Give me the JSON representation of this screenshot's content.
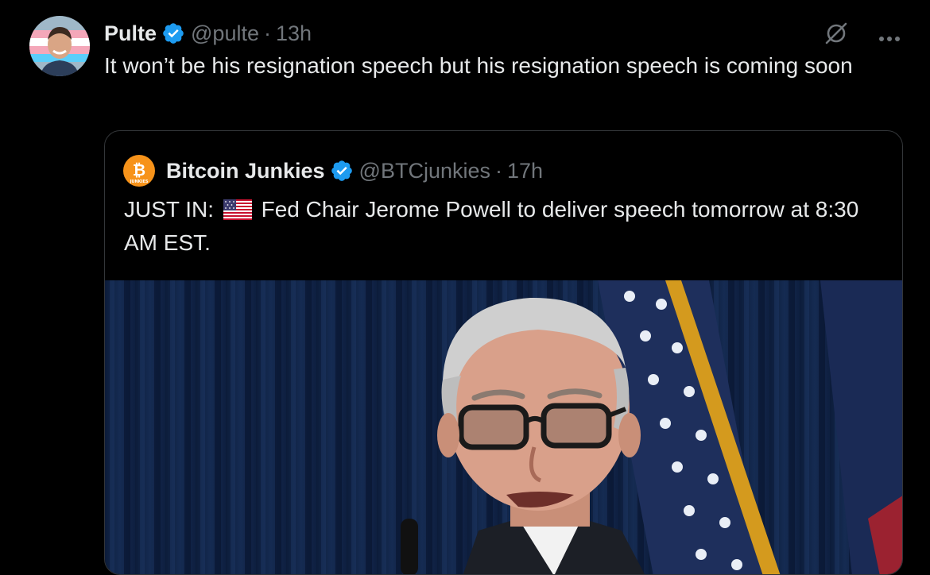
{
  "tweet": {
    "name": "Pulte",
    "handle": "@pulte",
    "separator": "·",
    "time": "13h",
    "text": "It won’t be his resignation speech but his resignation speech is coming soon",
    "more_label": "···"
  },
  "quote": {
    "name": "Bitcoin Junkies",
    "handle": "@BTCjunkies",
    "separator": "·",
    "time": "17h",
    "text_prefix": "JUST IN:",
    "text_rest": "Fed Chair Jerome Powell to deliver speech tomorrow at 8:30 AM EST.",
    "avatar_label": "JUNKIES"
  },
  "colors": {
    "background": "#000000",
    "text": "#e7e9ea",
    "muted": "#71767b",
    "verified": "#1d9bf0",
    "border": "#333639",
    "btc_orange": "#f7931a"
  },
  "icons": {
    "verified": "verified-badge-icon",
    "grok": "grok-icon",
    "more": "more-options-icon",
    "flag": "us-flag-icon"
  }
}
